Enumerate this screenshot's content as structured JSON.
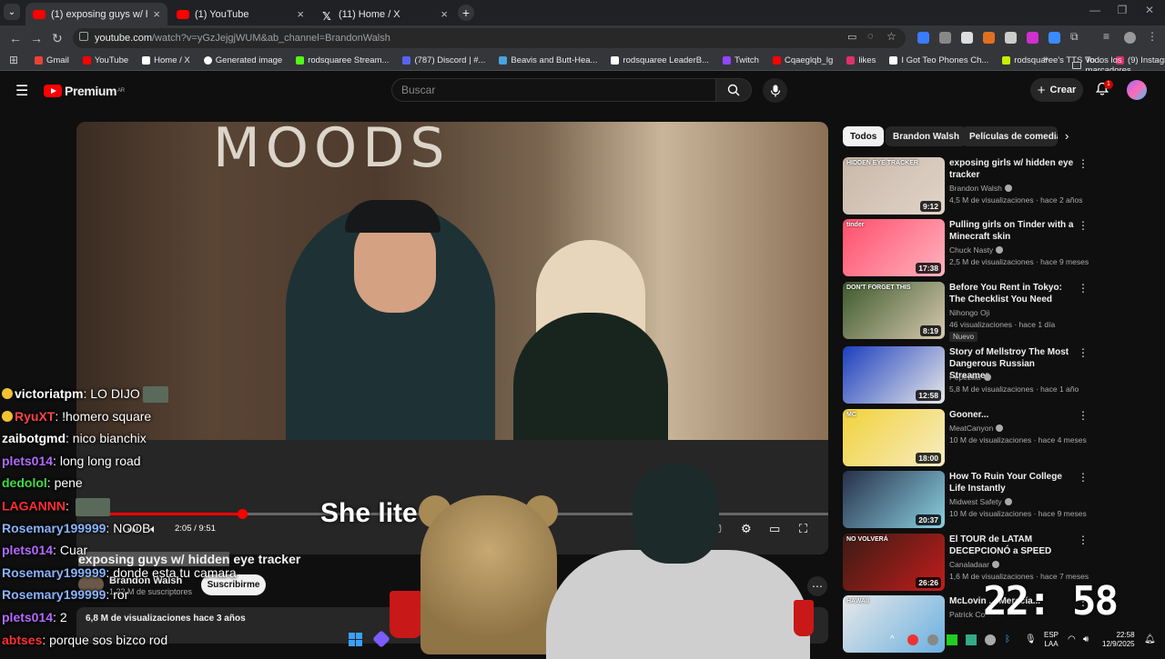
{
  "browser": {
    "tabs": [
      {
        "title": "(1) exposing guys w/ hidden ey",
        "icon": "youtube-icon",
        "active": true
      },
      {
        "title": "(1) YouTube",
        "icon": "youtube-icon",
        "active": false
      },
      {
        "title": "(11) Home / X",
        "icon": "x-icon",
        "active": false
      }
    ],
    "url_host": "youtube.com",
    "url_path": "/watch?v=yGzJejgjWUM&ab_channel=BrandonWalsh",
    "bookmarks": [
      {
        "label": "Gmail",
        "color": "#ea4335"
      },
      {
        "label": "YouTube",
        "color": "#ff0000"
      },
      {
        "label": "Home / X",
        "color": "#ffffff"
      },
      {
        "label": "Generated image",
        "color": "#ffffff"
      },
      {
        "label": "rodsquaree Stream...",
        "color": "#53fc18"
      },
      {
        "label": "(787) Discord | #...",
        "color": "#5865f2"
      },
      {
        "label": "Beavis and Butt-Hea...",
        "color": "#4aa3df"
      },
      {
        "label": "rodsquaree LeaderB...",
        "color": "#ffffff"
      },
      {
        "label": "Twitch",
        "color": "#9146ff"
      },
      {
        "label": "Cqaeglqb_lg",
        "color": "#ff0000"
      },
      {
        "label": "likes",
        "color": "#e1306c"
      },
      {
        "label": "I Got Teo Phones Ch...",
        "color": "#ffffff"
      },
      {
        "label": "rodsquaree's TTS Vo...",
        "color": "#c6f000"
      },
      {
        "label": "(9) Instagram",
        "color": "#e1306c"
      }
    ],
    "all_bookmarks": "Todos los marcadores"
  },
  "youtube": {
    "logo": "Premium",
    "logo_region": "AR",
    "search_placeholder": "Buscar",
    "create_label": "Crear",
    "notif_count": "1",
    "video": {
      "subtitle_text": "She lite            it!",
      "time": "2:05 / 9:51",
      "progress_fraction": 0.22,
      "title_highlighted": "exposing guys w/ hidden",
      "title_rest": " eye tracker",
      "channel": "Brandon Walsh",
      "subs": "1,22 M de suscriptores",
      "subscribe_label": "Suscribirme",
      "views": "6,8 M de visualizaciones  hace 3 años"
    },
    "chips": [
      "Todos",
      "Brandon Walsh",
      "Películas de comedia"
    ],
    "related": [
      {
        "title": "exposing girls w/ hidden eye tracker",
        "channel": "Brandon Walsh",
        "verified": true,
        "meta": "4,5 M de visualizaciones · hace 2 años",
        "duration": "9:12",
        "thumb": [
          "#c9b8aa",
          "#e0d4c8"
        ],
        "thumb_label": "HIDDEN EYE TRACKER"
      },
      {
        "title": "Pulling girls on Tinder with a Minecraft skin",
        "channel": "Chuck Nasty",
        "verified": true,
        "meta": "2,5 M de visualizaciones · hace 9 meses",
        "duration": "17:38",
        "thumb": [
          "#ff4e6a",
          "#ffb3c0"
        ],
        "thumb_label": "tinder"
      },
      {
        "title": "Before You Rent in Tokyo: The Checklist You Need",
        "channel": "Nihongo Oji",
        "verified": false,
        "meta": "46 visualizaciones · hace 1 día",
        "duration": "8:19",
        "thumb": [
          "#3c5a2c",
          "#d8c8b0"
        ],
        "thumb_label": "DON'T FORGET THIS",
        "badge": "Nuevo"
      },
      {
        "title": "Story of Mellstroy The Most Dangerous Russian Streamer",
        "channel": "Pepezilla",
        "verified": true,
        "meta": "5,8 M de visualizaciones · hace 1 año",
        "duration": "12:58",
        "thumb": [
          "#1d3fbf",
          "#e8e8e8"
        ],
        "thumb_label": ""
      },
      {
        "title": "Gooner...",
        "channel": "MeatCanyon",
        "verified": true,
        "meta": "10 M de visualizaciones · hace 4 meses",
        "duration": "18:00",
        "thumb": [
          "#f1d23a",
          "#f7ecc4"
        ],
        "thumb_label": "MC"
      },
      {
        "title": "How To Ruin Your College Life Instantly",
        "channel": "Midwest Safety",
        "verified": true,
        "meta": "10 M de visualizaciones · hace 9 meses",
        "duration": "20:37",
        "thumb": [
          "#27304a",
          "#8ad0e0"
        ],
        "thumb_label": ""
      },
      {
        "title": "El TOUR de LATAM DECEPCIONÓ a SPEED",
        "channel": "Canaladaar",
        "verified": true,
        "meta": "1,6 M de visualizaciones · hace 7 meses",
        "duration": "26:26",
        "thumb": [
          "#3a1c14",
          "#c21c1c"
        ],
        "thumb_label": "NO VOLVERÁ"
      },
      {
        "title": "McLovin ... Merecía...",
        "channel": "Patrick Co",
        "verified": false,
        "meta": "",
        "duration": "",
        "thumb": [
          "#e8e8e8",
          "#6ab0e0"
        ],
        "thumb_label": "HAWAII"
      }
    ]
  },
  "chat": [
    {
      "user": "victoriatpm",
      "color": "#ffffff",
      "msg": "LO DIJO",
      "emote": true,
      "badge": true
    },
    {
      "user": "RyuXT",
      "color": "#ff4545",
      "msg": "!homero square",
      "emote": false,
      "badge": true
    },
    {
      "user": "zaibotgmd",
      "color": "#ffffff",
      "msg": "nico bianchix",
      "emote": false,
      "badge": false
    },
    {
      "user": "plets014",
      "color": "#b36bff",
      "msg": "long long road",
      "emote": false,
      "badge": false
    },
    {
      "user": "dedolol",
      "color": "#3fdc3f",
      "msg": "pene",
      "emote": false,
      "badge": false
    },
    {
      "user": "LAGANNN",
      "color": "#ff3030",
      "msg": "",
      "emote": true,
      "badge": false
    },
    {
      "user": "Rosemary199999",
      "color": "#8ab4ff",
      "msg": "NOOB",
      "emote": false,
      "badge": false
    },
    {
      "user": "plets014",
      "color": "#b36bff",
      "msg": "Cuar",
      "emote": false,
      "badge": false
    },
    {
      "user": "Rosemary199999",
      "color": "#8ab4ff",
      "msg": "donde esta tu camara",
      "emote": false,
      "badge": false
    },
    {
      "user": "Rosemary199999",
      "color": "#8ab4ff",
      "msg": "ror",
      "emote": false,
      "badge": false
    },
    {
      "user": "plets014",
      "color": "#b36bff",
      "msg": "2",
      "emote": false,
      "badge": false
    },
    {
      "user": "abtses",
      "color": "#ff3030",
      "msg": "porque sos bizco rod",
      "emote": false,
      "badge": false
    }
  ],
  "overlay_clock": "22: 58",
  "taskbar": {
    "lang_top": "ESP",
    "lang_bottom": "LAA",
    "time": "22:58",
    "date": "12/9/2025"
  }
}
